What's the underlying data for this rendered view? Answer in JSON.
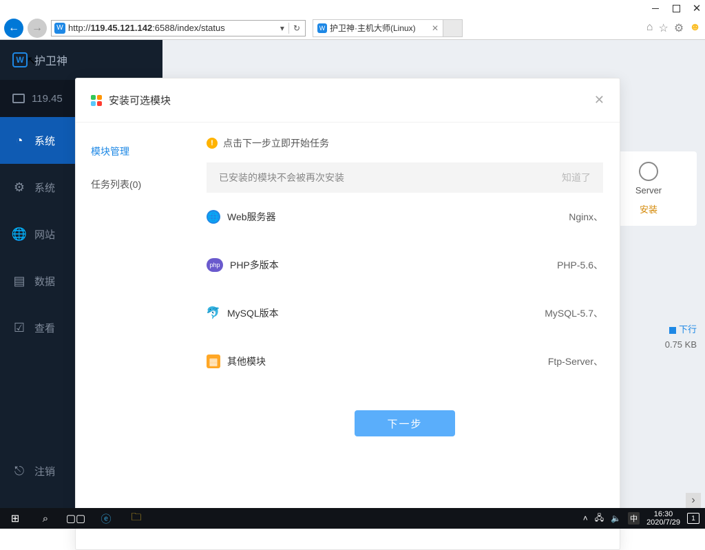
{
  "browser": {
    "url_host": "119.45.121.142",
    "url_prefix": "http://",
    "url_suffix": ":6588/index/status",
    "tab_title": "护卫神·主机大师(Linux)"
  },
  "sidebar": {
    "brand": "护卫神",
    "ip": "119.45",
    "items": [
      "系统",
      "系统",
      "网站",
      "数据",
      "查看",
      "注销"
    ]
  },
  "content": {
    "right_card_name": "Server",
    "right_card_action": "安装",
    "stat_label": "下行",
    "stat_value": "0.75 KB"
  },
  "modal": {
    "title": "安装可选模块",
    "side_tabs": [
      "模块管理",
      "任务列表(0)"
    ],
    "hint": "点击下一步立即开始任务",
    "banner_text": "已安装的模块不会被再次安装",
    "banner_action": "知道了",
    "rows": [
      {
        "icon": "globe",
        "name": "Web服务器",
        "value": "Nginx、"
      },
      {
        "icon": "php",
        "name": "PHP多版本",
        "value": "PHP-5.6、"
      },
      {
        "icon": "mysql",
        "name": "MySQL版本",
        "value": "MySQL-5.7、"
      },
      {
        "icon": "other",
        "name": "其他模块",
        "value": "Ftp-Server、"
      }
    ],
    "next_button": "下一步"
  },
  "taskbar": {
    "ime": "中",
    "time": "16:30",
    "date": "2020/7/29",
    "notif_count": "1"
  }
}
